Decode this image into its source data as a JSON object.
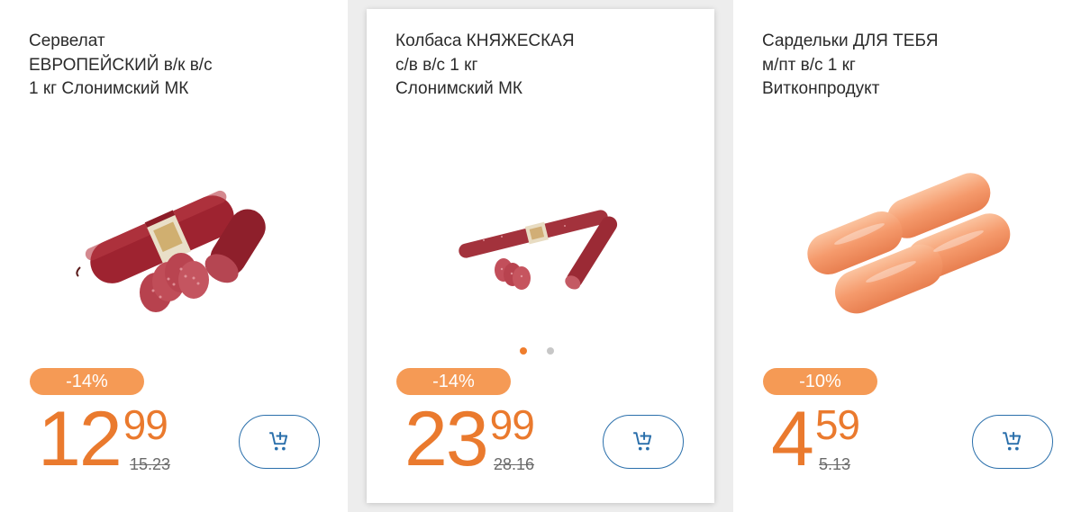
{
  "products": [
    {
      "title": "Сервелат\nЕВРОПЕЙСКИЙ в/к в/с\n1 кг Слонимский МК",
      "discount": "-14%",
      "price_int": "12",
      "price_cents": "99",
      "old_price": "15.23",
      "image": "servelat-image"
    },
    {
      "title": "Колбаса КНЯЖЕСКАЯ\nс/в в/с 1 кг\nСлонимский МК",
      "discount": "-14%",
      "price_int": "23",
      "price_cents": "99",
      "old_price": "28.16",
      "image": "kolbasa-image"
    },
    {
      "title": "Сардельки ДЛЯ ТЕБЯ\nм/пт в/с 1 кг\nВитконпродукт",
      "discount": "-10%",
      "price_int": "4",
      "price_cents": "59",
      "old_price": "5.13",
      "image": "sardelki-image"
    }
  ],
  "colors": {
    "accent_orange": "#ea7a2e",
    "badge_orange": "#f59a55",
    "cart_blue": "#2a6fab",
    "background": "#ededed"
  },
  "icons": {
    "cart": "add-to-cart-icon"
  }
}
